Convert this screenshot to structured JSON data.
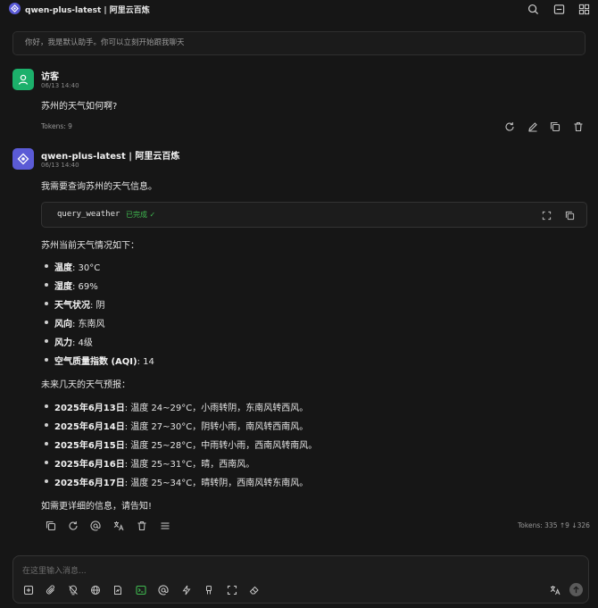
{
  "window": {
    "title": "qwen-plus-latest | 阿里云百炼"
  },
  "welcome": {
    "text": "你好，我是默认助手。你可以立刻开始跟我聊天"
  },
  "user_message": {
    "sender": "访客",
    "time": "06/13 14:40",
    "text": "苏州的天气如何啊?",
    "tokens": "Tokens: 9"
  },
  "assistant_message": {
    "sender": "qwen-plus-latest | 阿里云百炼",
    "time": "06/13 14:40",
    "intro": "我需要查询苏州的天气信息。",
    "tool": {
      "name": "query_weather",
      "status": "已完成"
    },
    "current_heading": "苏州当前天气情况如下：",
    "current": [
      {
        "label": "温度",
        "value": ": 30°C"
      },
      {
        "label": "湿度",
        "value": ": 69%"
      },
      {
        "label": "天气状况",
        "value": ": 阴"
      },
      {
        "label": "风向",
        "value": ": 东南风"
      },
      {
        "label": "风力",
        "value": ": 4级"
      },
      {
        "label": "空气质量指数 (AQI)",
        "value": ": 14"
      }
    ],
    "forecast_heading": "未来几天的天气预报：",
    "forecast": [
      {
        "label": "2025年6月13日",
        "value": ": 温度 24~29°C，小雨转阴，东南风转西风。"
      },
      {
        "label": "2025年6月14日",
        "value": ": 温度 27~30°C，阴转小雨，南风转西南风。"
      },
      {
        "label": "2025年6月15日",
        "value": ": 温度 25~28°C，中雨转小雨，西南风转南风。"
      },
      {
        "label": "2025年6月16日",
        "value": ": 温度 25~31°C，晴，西南风。"
      },
      {
        "label": "2025年6月17日",
        "value": ": 温度 25~34°C，晴转阴，西南风转东南风。"
      }
    ],
    "closing": "如需更详细的信息，请告知!",
    "tokens": "Tokens: 335 ↑9 ↓326"
  },
  "input": {
    "placeholder": "在这里输入消息..."
  },
  "colors": {
    "accent": "#5b5bd6",
    "user_avatar": "#1cb06b",
    "success": "#3fb950",
    "background": "#161616"
  }
}
